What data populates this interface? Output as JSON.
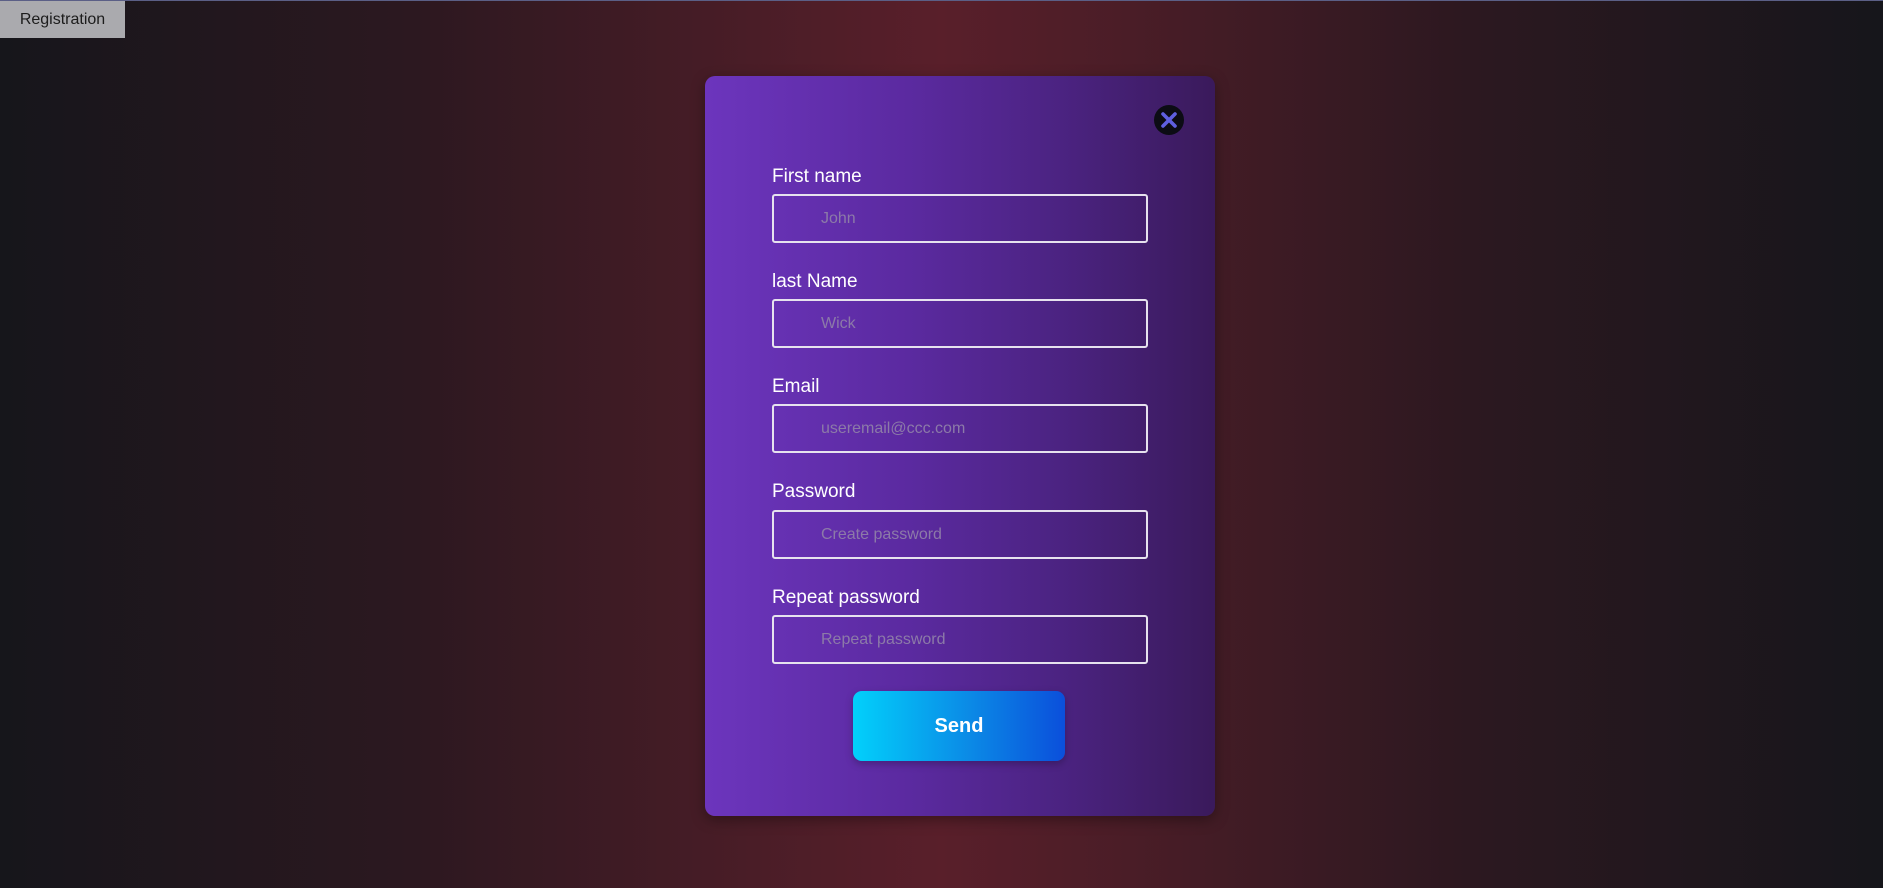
{
  "header": {
    "tab_label": "Registration"
  },
  "form": {
    "close_icon": "close-icon",
    "fields": [
      {
        "label": "First name",
        "placeholder": "John",
        "value": ""
      },
      {
        "label": "last Name",
        "placeholder": "Wick",
        "value": ""
      },
      {
        "label": "Email",
        "placeholder": "useremail@ccc.com",
        "value": ""
      },
      {
        "label": "Password",
        "placeholder": "Create password",
        "value": ""
      },
      {
        "label": "Repeat password",
        "placeholder": "Repeat password",
        "value": ""
      }
    ],
    "submit_label": "Send"
  },
  "colors": {
    "modal_gradient_start": "#6c35bd",
    "modal_gradient_end": "#3a1a5b",
    "button_gradient_start": "#02d0fb",
    "button_gradient_end": "#0b4fdb",
    "close_icon": "#5f5fe0"
  }
}
